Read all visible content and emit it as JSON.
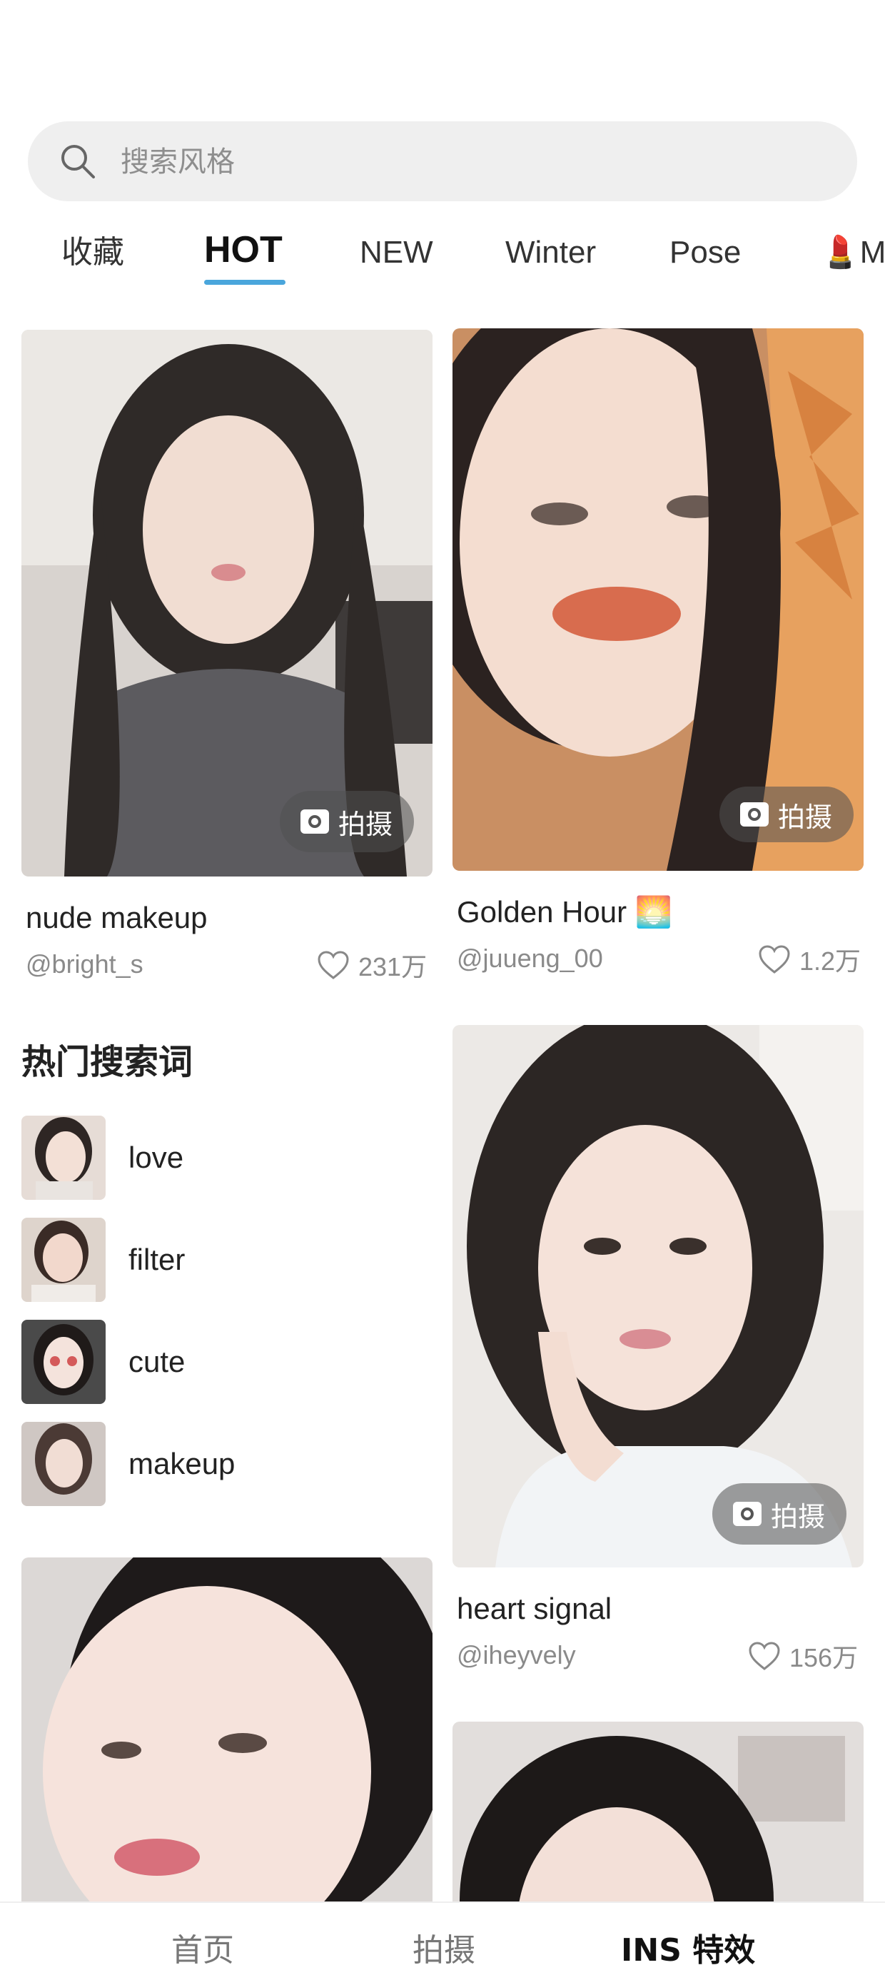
{
  "search": {
    "placeholder": "搜索风格",
    "icon": "search-icon"
  },
  "tabs": [
    {
      "label": "收藏",
      "active": false
    },
    {
      "label": "HOT",
      "active": true
    },
    {
      "label": "NEW",
      "active": false
    },
    {
      "label": "Winter",
      "active": false
    },
    {
      "label": "Pose",
      "active": false
    },
    {
      "label": "💄M",
      "active": false
    }
  ],
  "cards": [
    {
      "title": "nude makeup",
      "user": "@bright_s",
      "likes": "231万",
      "shoot_label": "拍摄"
    },
    {
      "title": "Golden Hour 🌅",
      "user": "@juueng_00",
      "likes": "1.2万",
      "shoot_label": "拍摄"
    },
    {
      "title": "heart signal",
      "user": "@iheyvely",
      "likes": "156万",
      "shoot_label": "拍摄"
    }
  ],
  "hot_search": {
    "title": "热门搜索词",
    "items": [
      {
        "label": "love"
      },
      {
        "label": "filter"
      },
      {
        "label": "cute"
      },
      {
        "label": "makeup"
      }
    ]
  },
  "bottom_nav": [
    {
      "label": "首页",
      "active": false
    },
    {
      "label": "拍摄",
      "active": false
    },
    {
      "label": "INS 特效",
      "active": true
    }
  ],
  "colors": {
    "accent": "#4aa6dc",
    "search_bg": "#efefef",
    "muted_text": "#8a8a8a"
  }
}
